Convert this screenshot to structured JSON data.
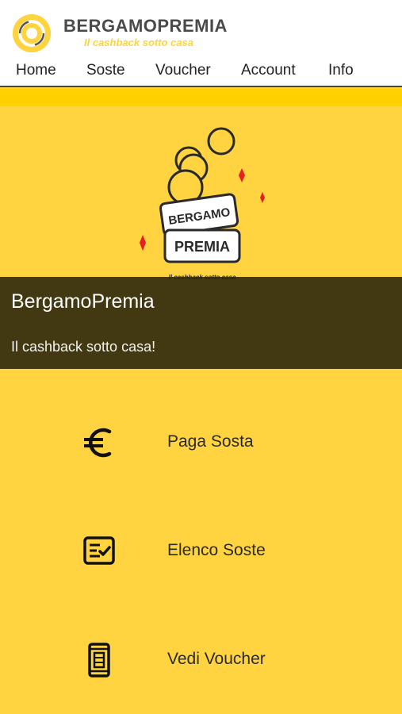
{
  "header": {
    "brand": "BERGAMOPREMIA",
    "tagline": "Il cashback sotto casa",
    "nav": [
      "Home",
      "Soste",
      "Voucher",
      "Account",
      "Info"
    ]
  },
  "hero": {
    "logo_text_top": "BERGAMO",
    "logo_text_bottom": "PREMIA",
    "logo_tagline": "Il cashback sotto casa"
  },
  "banner": {
    "title": "BergamoPremia",
    "subtitle": "Il cashback sotto casa!"
  },
  "menu": [
    {
      "label": "Paga Sosta",
      "icon": "euro-icon"
    },
    {
      "label": "Elenco Soste",
      "icon": "checklist-icon"
    },
    {
      "label": "Vedi Voucher",
      "icon": "phone-voucher-icon"
    }
  ],
  "colors": {
    "accent": "#FFD440",
    "stripe": "#FFD000",
    "banner": "#2a220a",
    "sparkle": "#E62020"
  }
}
